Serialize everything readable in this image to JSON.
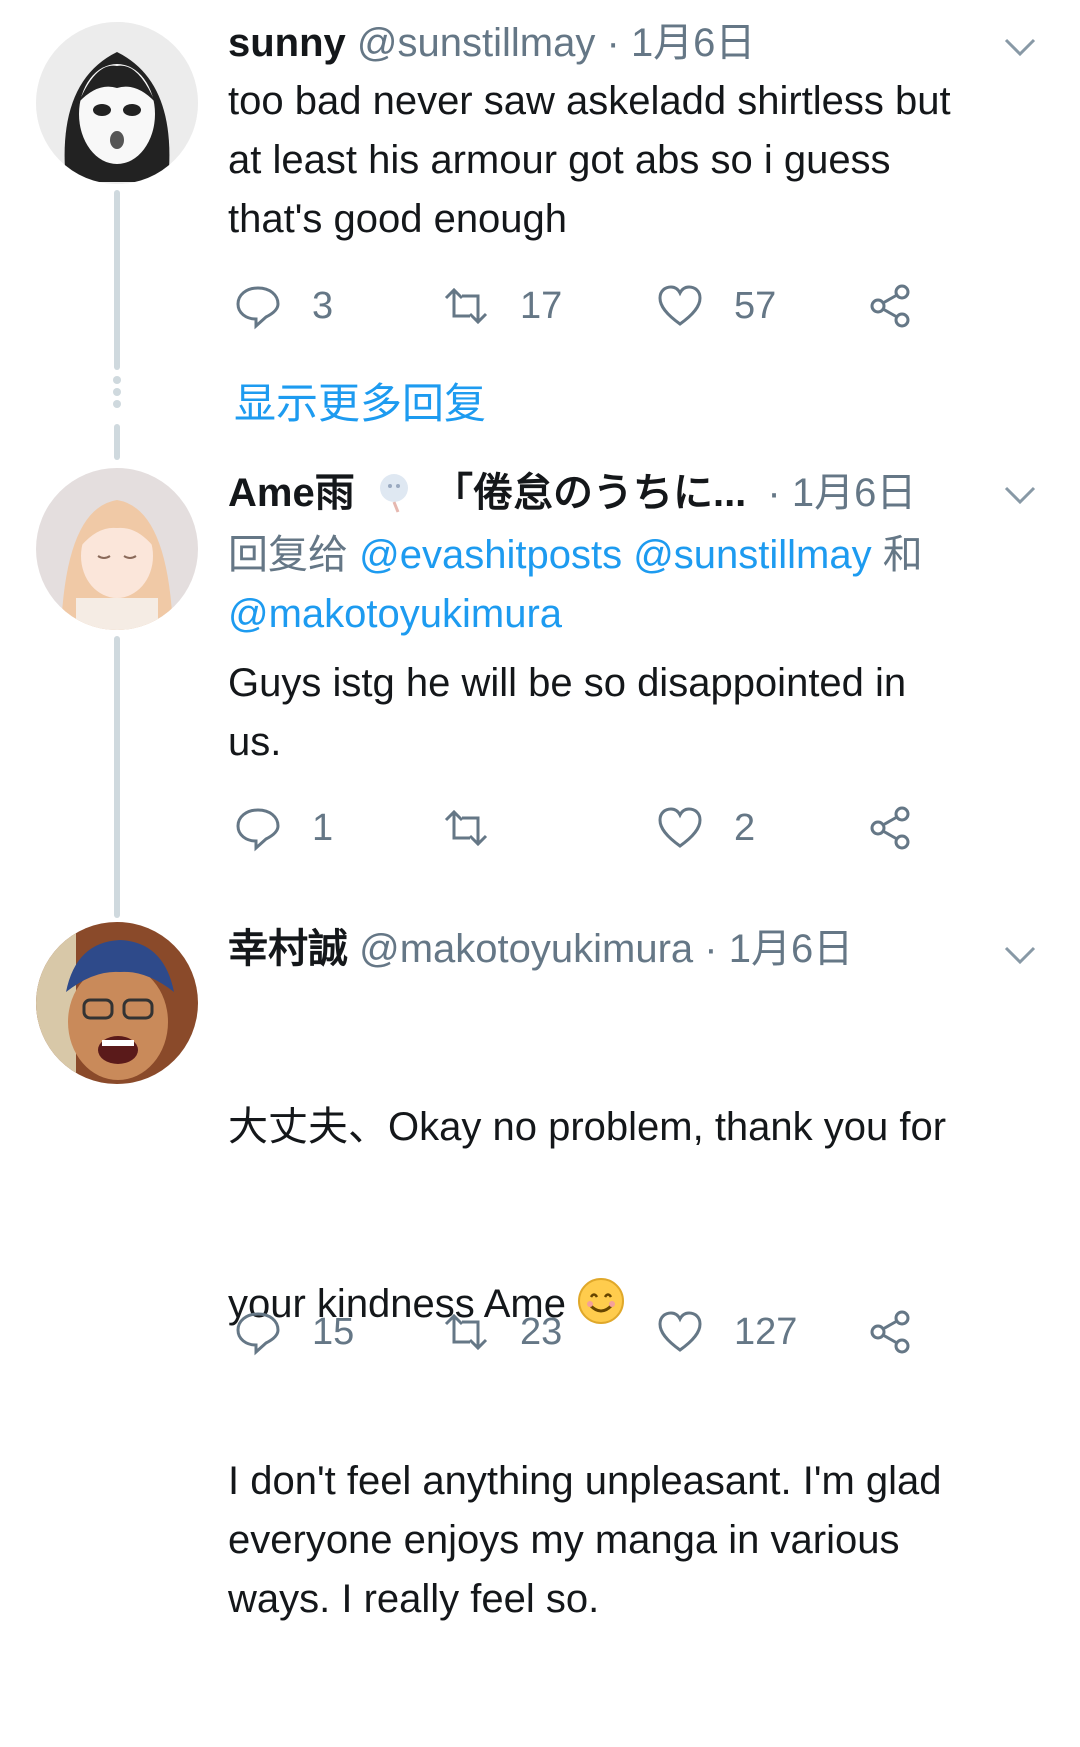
{
  "tweets": [
    {
      "name": "sunny",
      "handle": "@sunstillmay",
      "sep": "·",
      "date": "1月6日",
      "text": "too bad never saw askeladd shirtless but\nat least his armour got abs so i guess\nthat's good enough",
      "replies": "3",
      "retweets": "17",
      "likes": "57"
    },
    {
      "name": "Ame雨",
      "display_extra": "「倦怠のうちに...",
      "sep": "·",
      "date": "1月6日",
      "reply_prefix": "回复给",
      "reply_mentions_1": "@evashitposts @sunstillmay",
      "reply_conj": "和",
      "reply_mentions_2": "@makotoyukimura",
      "text": "Guys istg he will be so disappointed in\nus.",
      "replies": "1",
      "retweets": "",
      "likes": "2"
    },
    {
      "name": "幸村誠",
      "handle": "@makotoyukimura",
      "sep": "·",
      "date": "1月6日",
      "text_line1": "大丈夫、Okay no problem, thank you for",
      "text_line2": "your kindness Ame",
      "text_rest": "I don't feel anything unpleasant. I'm glad\neveryone enjoys my manga in various\nways. I really feel so.",
      "replies": "15",
      "retweets": "23",
      "likes": "127"
    }
  ],
  "show_more_replies": "显示更多回复",
  "colors": {
    "accent": "#1d9bf0",
    "muted": "#657786",
    "line": "#cfd9de"
  }
}
